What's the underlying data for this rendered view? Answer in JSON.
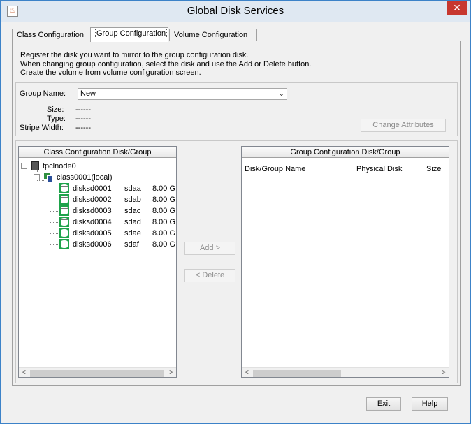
{
  "window": {
    "title": "Global Disk Services",
    "app_icon": "java-icon",
    "close_icon": "close-icon"
  },
  "tabs": [
    {
      "label": "Class Configuration",
      "active": false
    },
    {
      "label": "Group Configuration",
      "active": true
    },
    {
      "label": "Volume Configuration",
      "active": false
    }
  ],
  "description": [
    "Register the disk you want to mirror to the group configuration disk.",
    "When changing group configuration, select the disk and use the Add or Delete button.",
    "Create the volume from volume configuration screen."
  ],
  "group": {
    "name_label": "Group Name:",
    "name_value": "New",
    "size_label": "Size:",
    "size_value": "------",
    "type_label": "Type:",
    "type_value": "------",
    "stripe_label": "Stripe Width:",
    "stripe_value": "------",
    "change_attributes": "Change Attributes"
  },
  "left_panel": {
    "header": "Class Configuration Disk/Group",
    "host": "tpclnode0",
    "class": "class0001(local)",
    "disks": [
      {
        "name": "disksd0001",
        "physical": "sdaa",
        "size": "8.00 G"
      },
      {
        "name": "disksd0002",
        "physical": "sdab",
        "size": "8.00 G"
      },
      {
        "name": "disksd0003",
        "physical": "sdac",
        "size": "8.00 G"
      },
      {
        "name": "disksd0004",
        "physical": "sdad",
        "size": "8.00 G"
      },
      {
        "name": "disksd0005",
        "physical": "sdae",
        "size": "8.00 G"
      },
      {
        "name": "disksd0006",
        "physical": "sdaf",
        "size": "8.00 G"
      }
    ],
    "expander_symbol": "−"
  },
  "middle": {
    "add": "Add >",
    "delete": "< Delete"
  },
  "right_panel": {
    "header": "Group Configuration Disk/Group",
    "columns": [
      "Disk/Group Name",
      "Physical Disk",
      "Size"
    ]
  },
  "footer": {
    "exit": "Exit",
    "help": "Help"
  },
  "scroll": {
    "left_arrow": "<",
    "right_arrow": ">"
  },
  "combo_arrow": "⌄"
}
